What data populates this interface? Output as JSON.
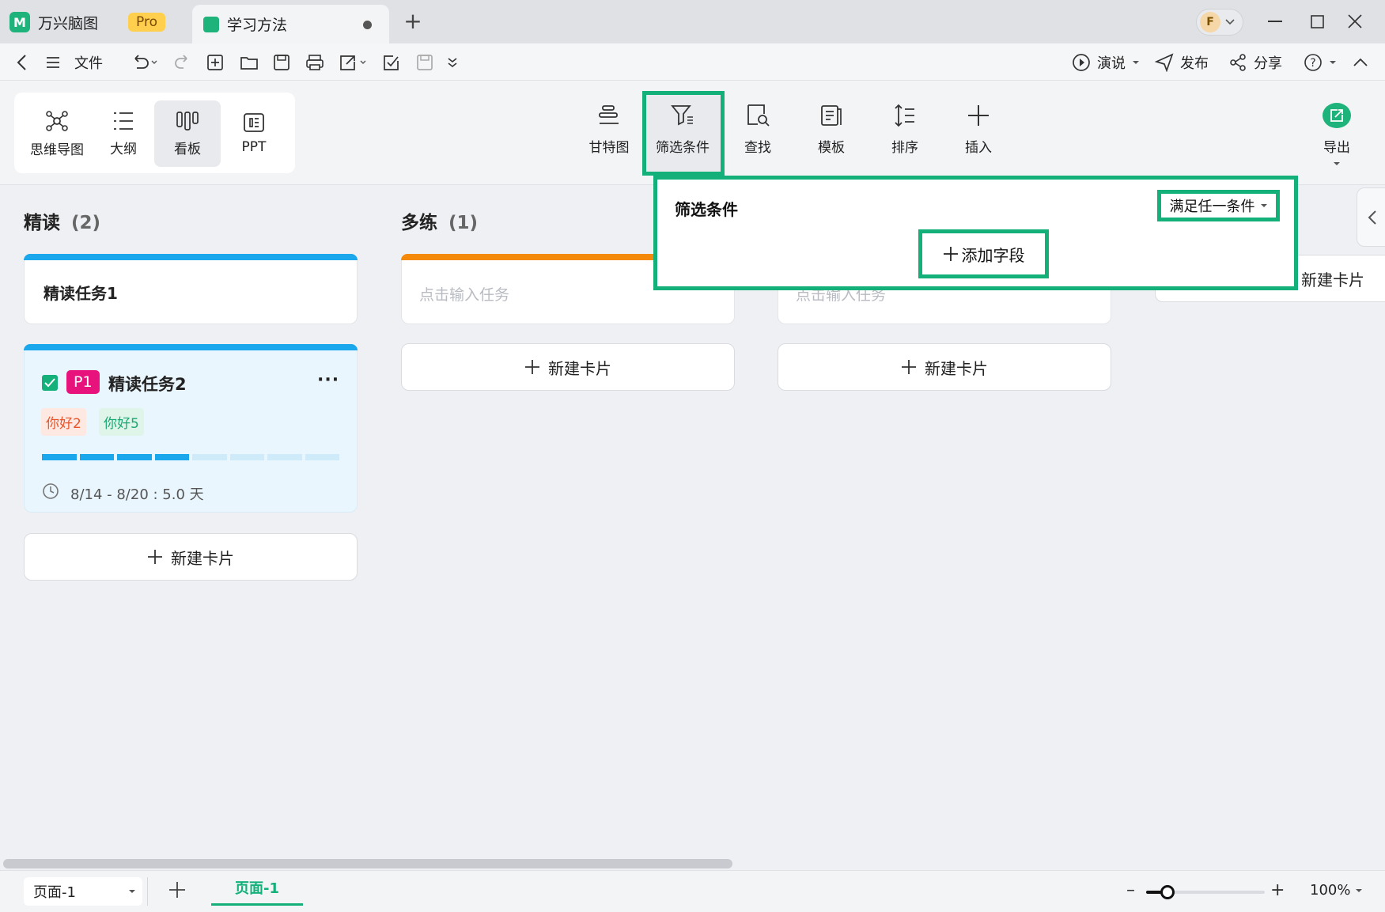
{
  "titlebar": {
    "app_name": "万兴脑图",
    "pro_badge": "Pro",
    "doc_tab": "学习方法",
    "new_tab": "+",
    "avatar_letter": "F"
  },
  "menubar": {
    "file_label": "文件",
    "present_label": "演说",
    "publish_label": "发布",
    "share_label": "分享"
  },
  "views": [
    {
      "label": "思维导图",
      "icon": "mindmap-icon"
    },
    {
      "label": "大纲",
      "icon": "outline-icon"
    },
    {
      "label": "看板",
      "icon": "kanban-icon"
    },
    {
      "label": "PPT",
      "icon": "ppt-icon"
    }
  ],
  "ribbon": {
    "gantt": "甘特图",
    "filter": "筛选条件",
    "find": "查找",
    "template": "模板",
    "sort": "排序",
    "insert": "插入",
    "export": "导出"
  },
  "filter_popup": {
    "title": "筛选条件",
    "condition": "满足任一条件",
    "add_field": "添加字段"
  },
  "columns": [
    {
      "title": "精读",
      "count": "(2)",
      "accent": "#1aa7ec",
      "cards": [
        {
          "title": "精读任务1"
        },
        {
          "priority": "P1",
          "title": "精读任务2",
          "tags": [
            "你好2",
            "你好5"
          ],
          "progress": 0.5,
          "date": "8/14 - 8/20 : 5.0 天"
        }
      ],
      "new_card": "新建卡片"
    },
    {
      "title": "多练",
      "count": "(1)",
      "accent": "#f5890a",
      "cards": [
        {
          "placeholder": "点击输入任务"
        }
      ],
      "new_card": "新建卡片"
    },
    {
      "cards": [
        {
          "placeholder": "点击输入任务"
        }
      ],
      "new_card": "新建卡片"
    },
    {
      "new_card": "新建卡片"
    }
  ],
  "statusbar": {
    "page_select": "页面-1",
    "page_tab": "页面-1",
    "zoom": "100%",
    "zoom_level": 0.18
  },
  "colors": {
    "brand_green": "#1eb37a",
    "highlight": "#13b07a",
    "priority_pink": "#e8127c",
    "tag_red": "#e8542a",
    "tag_green": "#1aa873"
  }
}
